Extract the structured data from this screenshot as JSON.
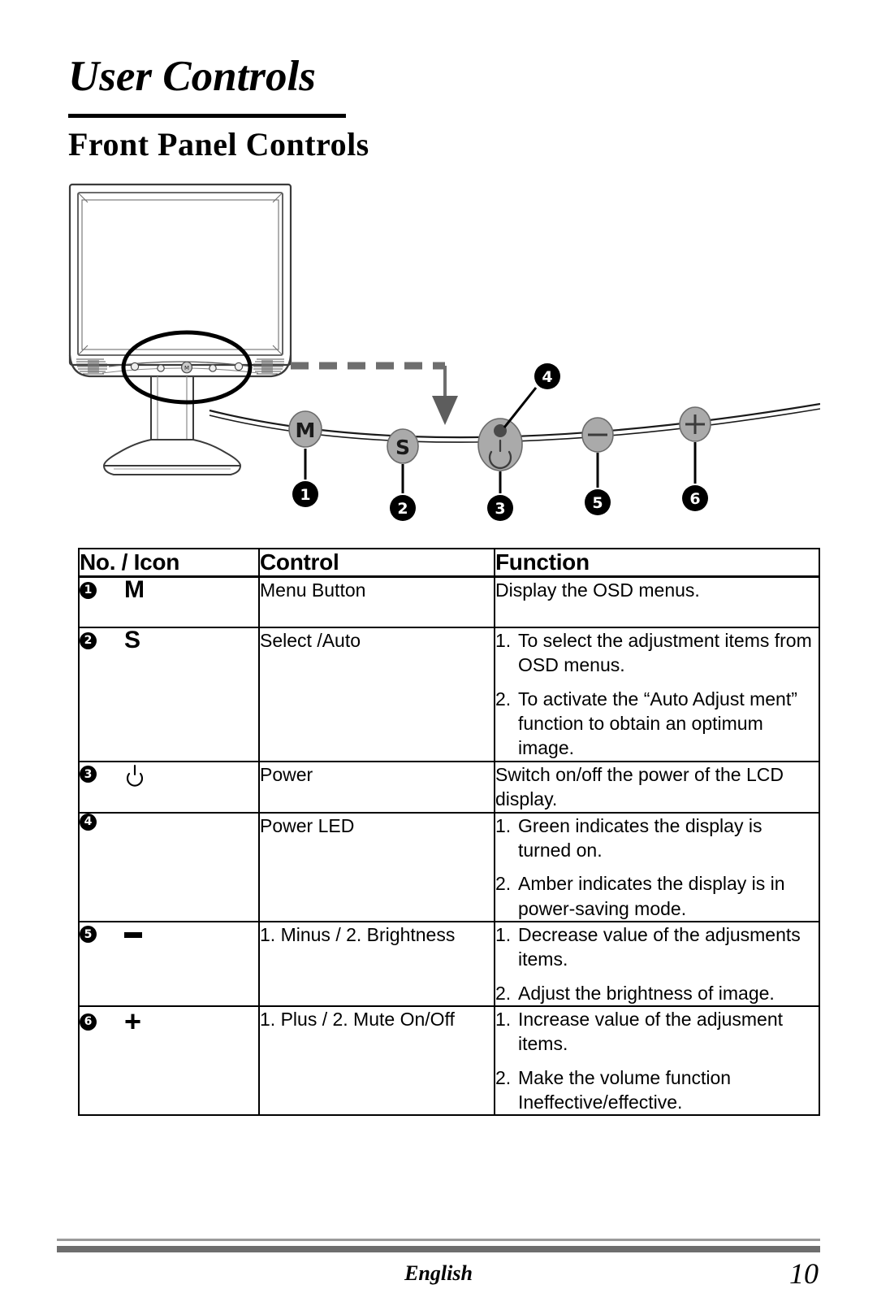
{
  "page": {
    "title": "User Controls",
    "section_title": "Front Panel Controls"
  },
  "illustration": {
    "buttons": [
      {
        "id": "menu",
        "glyph": "M",
        "callout": "1"
      },
      {
        "id": "select",
        "glyph": "S",
        "callout": "2"
      },
      {
        "id": "power",
        "glyph": "power-symbol",
        "callout": "3"
      },
      {
        "id": "minus",
        "glyph": "–",
        "callout": "5"
      },
      {
        "id": "plus",
        "glyph": "+",
        "callout": "6"
      }
    ],
    "led_callout": "4",
    "colors": {
      "button_fill": "#aaaaaa",
      "button_stroke": "#6b6b6b",
      "led_dot": "#4a4a4a",
      "dashed_line": "#6e6e6e",
      "outline": "#3b3b3b"
    }
  },
  "table": {
    "headers": [
      "No. / Icon",
      "Control",
      "Function"
    ],
    "rows": [
      {
        "number": "1",
        "icon_kind": "letter",
        "icon": "M",
        "control": "Menu Button",
        "function_plain": "Display the OSD menus.",
        "function_list": []
      },
      {
        "number": "2",
        "icon_kind": "letter",
        "icon": "S",
        "control": "Select /Auto",
        "function_plain": "",
        "function_list": [
          {
            "marker": "1.",
            "text": "To select the adjustment items from OSD menus."
          },
          {
            "marker": "2.",
            "text": "To activate the “Auto Adjust ment” function to obtain an optimum image."
          }
        ]
      },
      {
        "number": "3",
        "icon_kind": "power",
        "icon": "power-symbol",
        "control": "Power",
        "function_plain": "Switch on/off the power of the LCD display.",
        "function_list": []
      },
      {
        "number": "4",
        "icon_kind": "none",
        "icon": "",
        "control": "Power LED",
        "function_plain": "",
        "function_list": [
          {
            "marker": "1.",
            "text": "Green indicates the display is turned on."
          },
          {
            "marker": "2.",
            "text": "Amber indicates the display is in power-saving mode."
          }
        ]
      },
      {
        "number": "5",
        "icon_kind": "minus",
        "icon": "–",
        "control": "1. Minus / 2. Brightness",
        "function_plain": "",
        "function_list": [
          {
            "marker": "1.",
            "text": "Decrease value of the adjusments items."
          },
          {
            "marker": "2.",
            "text": "Adjust the brightness of image."
          }
        ]
      },
      {
        "number": "6",
        "icon_kind": "plus",
        "icon": "+",
        "control": "1. Plus  / 2. Mute On/Off",
        "function_plain": "",
        "function_list": [
          {
            "marker": "1.",
            "text": "Increase value of the adjusment items."
          },
          {
            "marker": "2.",
            "text": "Make the volume function Ineffective/effective."
          }
        ]
      }
    ]
  },
  "footer": {
    "language": "English",
    "page_number": "10"
  }
}
